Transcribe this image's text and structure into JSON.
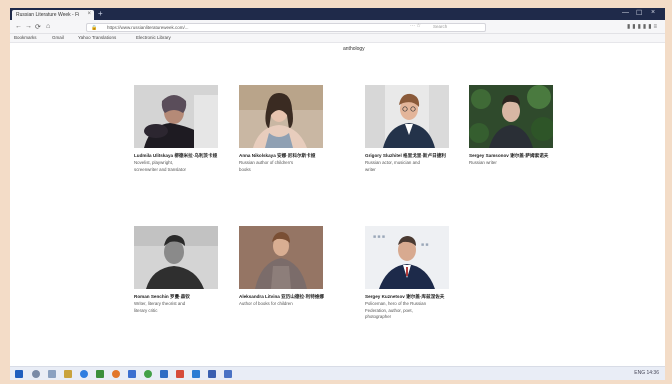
{
  "browser": {
    "tab_title": "Russian Literature Week - Fi",
    "tab_close": "×",
    "new_tab": "+",
    "url": "https://www.russianliteratureweek.com/...",
    "search_placeholder": "Search",
    "window_controls": [
      "—",
      "☐",
      "×"
    ],
    "bookmarks": [
      "Bookmarks",
      "Gmail",
      "Yahoo Translations",
      "Electronic Library"
    ]
  },
  "page": {
    "top_text": "anthology",
    "authors": [
      {
        "name": "Ludmila Ulitskaya 柳德米拉·乌利茨卡娅",
        "desc": [
          "Novelist, playwright,",
          "screenwriter and translator"
        ]
      },
      {
        "name": "Anna Nikolskaya 安娜·尼科尔斯卡娅",
        "desc": [
          "Russian author of children's",
          "books"
        ]
      },
      {
        "name": "Grigory Sluzhitel 格里戈里·斯卢日捷利",
        "desc": [
          "Russian actor, musician and",
          "writer"
        ]
      },
      {
        "name": "Sergey Samsonov 谢尔盖·萨姆索诺夫",
        "desc": [
          "Russian writer"
        ]
      },
      {
        "name": "Roman Senchin 罗曼·森钦",
        "desc": [
          "Writer, literary theorist and",
          "literary critic"
        ]
      },
      {
        "name": "Aleksandra Litvina 亚历山德拉·利特维娜",
        "desc": [
          "Author of books for children"
        ]
      },
      {
        "name": "Sergey Kuznetsov 谢尔盖·库兹涅佐夫",
        "desc": [
          "Policeman, hero of the Russian",
          "Federation, author, poet,",
          "photographer"
        ]
      }
    ]
  },
  "taskbar": {
    "tray_text": "ENG 14:36"
  }
}
